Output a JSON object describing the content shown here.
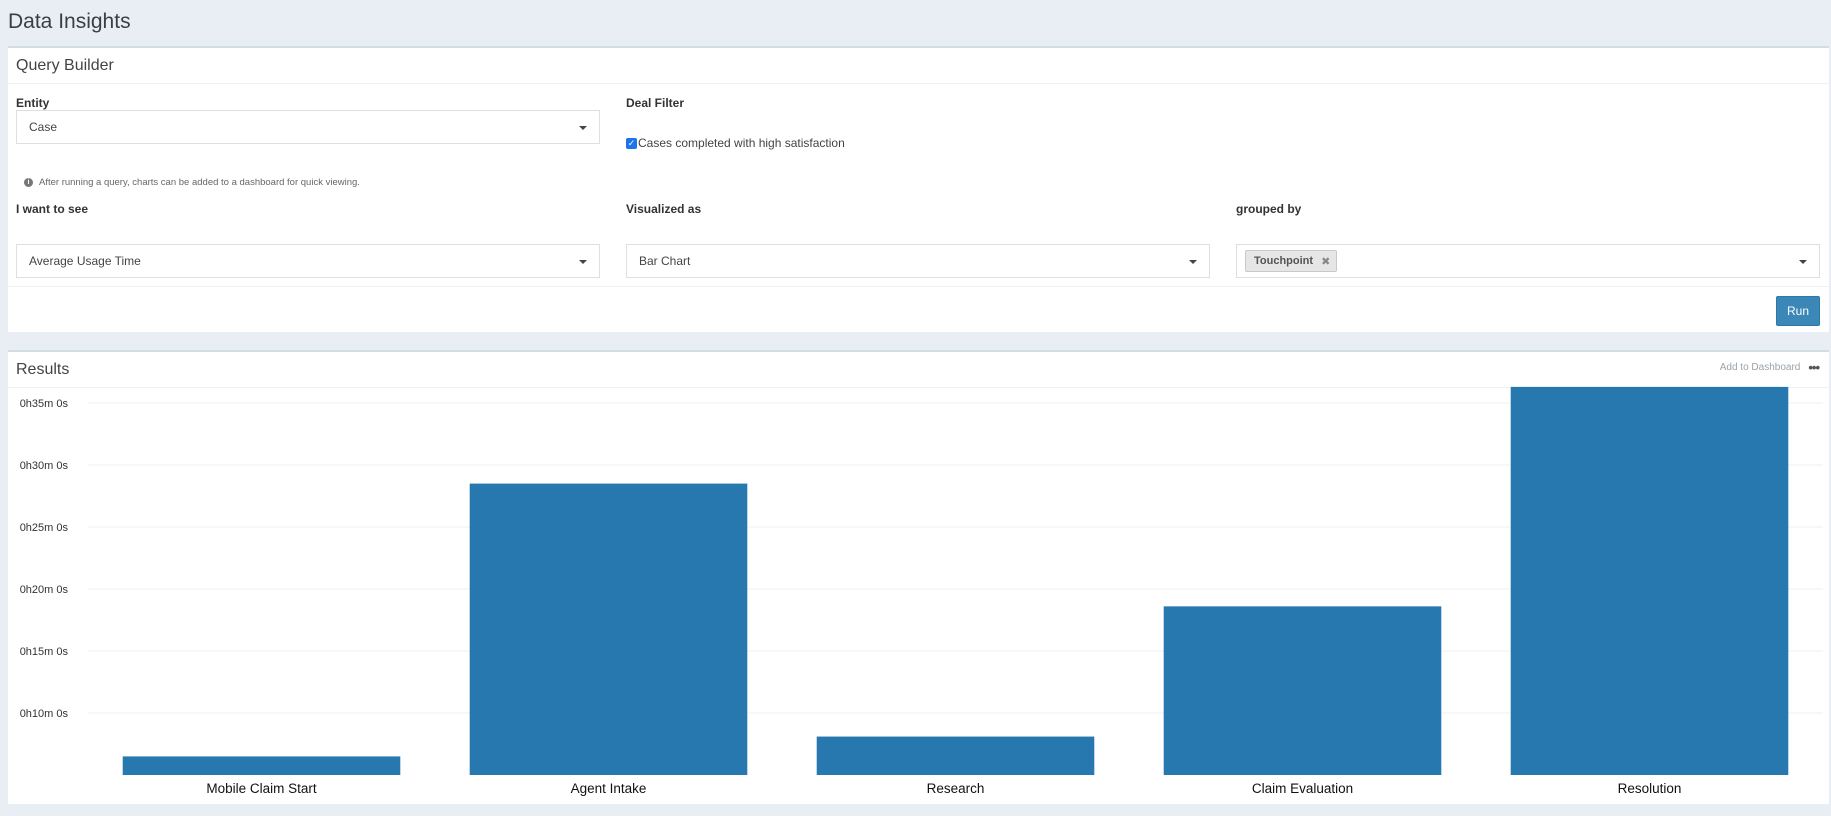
{
  "app": {
    "title": "Data Insights"
  },
  "query_builder": {
    "title": "Query Builder",
    "entity": {
      "label": "Entity",
      "value": "Case"
    },
    "deal_filter": {
      "label": "Deal Filter",
      "option": "Cases completed with high satisfaction",
      "checked": true
    },
    "hint": "After running a query, charts can be added to a dashboard for quick viewing.",
    "want_to_see": {
      "label": "I want to see",
      "value": "Average Usage Time"
    },
    "visualized_as": {
      "label": "Visualized as",
      "value": "Bar Chart"
    },
    "grouped_by": {
      "label": "grouped by",
      "tags": [
        "Touchpoint"
      ]
    },
    "run_label": "Run"
  },
  "results": {
    "title": "Results",
    "add_to_dashboard": "Add to Dashboard",
    "more": "•••"
  },
  "colors": {
    "bar": "#2878b0",
    "run_button": "#3a87b8",
    "background": "#e8eef3"
  },
  "icons": {
    "info": "info-icon",
    "dropdown": "chevron-down-icon",
    "remove_tag": "close-icon",
    "more": "ellipsis-icon"
  },
  "chart_data": {
    "type": "bar",
    "categories": [
      "Mobile Claim Start",
      "Agent Intake",
      "Research",
      "Claim Evaluation",
      "Resolution"
    ],
    "values": [
      6.5,
      28.5,
      8.1,
      18.6,
      36.3
    ],
    "value_unit": "minutes",
    "yticks": [
      10,
      15,
      20,
      25,
      30,
      35
    ],
    "ytick_labels": [
      "0h10m 0s",
      "0h15m 0s",
      "0h20m 0s",
      "0h25m 0s",
      "0h30m 0s",
      "0h35m 0s"
    ],
    "ylim": [
      5,
      37.5
    ],
    "grid": true,
    "legend": "none"
  }
}
